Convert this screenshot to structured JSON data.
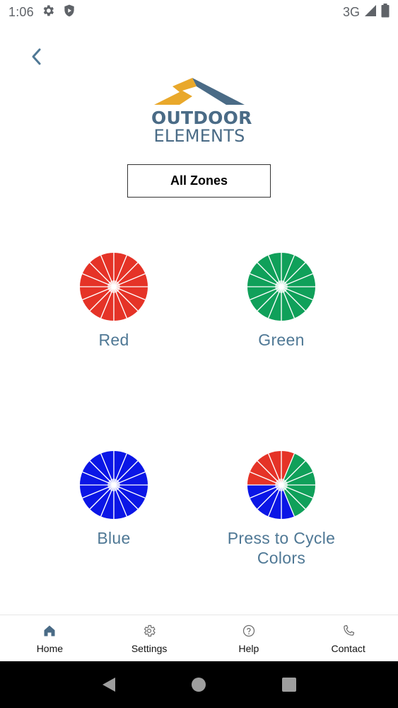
{
  "status_bar": {
    "time": "1:06",
    "network": "3G"
  },
  "logo": {
    "line1": "OUTDOOR",
    "line2": "ELEMENTS",
    "colors": {
      "accent": "#e9a82b",
      "brand": "#4a6b86"
    }
  },
  "zone_selector": {
    "label": "All Zones"
  },
  "color_options": [
    {
      "label": "Red",
      "color": "#e53327",
      "icon": "red-color-wheel-icon"
    },
    {
      "label": "Green",
      "color": "#10a05a",
      "icon": "green-color-wheel-icon"
    },
    {
      "label": "Blue",
      "color": "#0b16e6",
      "icon": "blue-color-wheel-icon"
    },
    {
      "label": "Press to Cycle Colors",
      "colors": [
        "#e53327",
        "#10a05a",
        "#0b16e6"
      ],
      "icon": "multicolor-wheel-icon"
    }
  ],
  "bottom_nav": [
    {
      "label": "Home",
      "icon": "home-icon",
      "active": true
    },
    {
      "label": "Settings",
      "icon": "gear-icon"
    },
    {
      "label": "Help",
      "icon": "help-icon"
    },
    {
      "label": "Contact",
      "icon": "phone-icon"
    }
  ],
  "theme": {
    "label_color": "#4f7895",
    "back_arrow_color": "#4f7895",
    "nav_icon_active": "#4a6b86",
    "nav_icon_inactive": "#6e6e6e"
  }
}
